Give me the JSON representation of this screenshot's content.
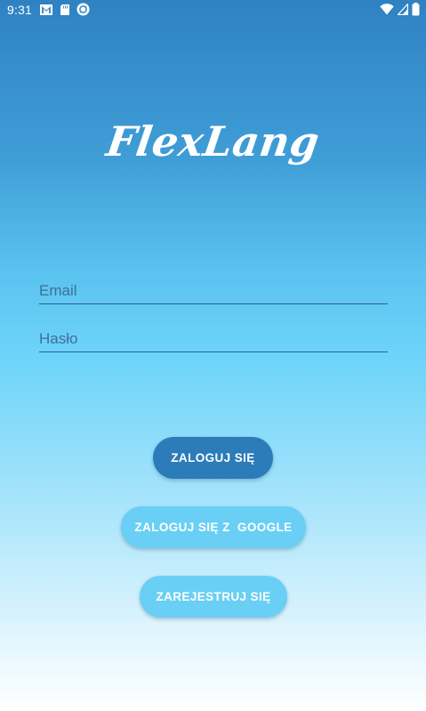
{
  "status_bar": {
    "time": "9:31",
    "left_icons": [
      "gmail-icon",
      "sd-card-icon",
      "sync-icon"
    ],
    "right_icons": [
      "wifi-icon",
      "signal-icon",
      "battery-icon"
    ]
  },
  "app": {
    "logo_text": "FlexLang"
  },
  "form": {
    "email_placeholder": "Email",
    "password_placeholder": "Hasło"
  },
  "buttons": {
    "login": "ZALOGUJ SIĘ",
    "google": "ZALOGUJ SIĘ Z  GOOGLE",
    "register": "ZAREJESTRUJ SIĘ"
  },
  "colors": {
    "primary_button": "#2b7cb8",
    "secondary_button": "#69cff5",
    "gradient_top": "#2f82c2",
    "gradient_bottom": "#ffffff"
  }
}
